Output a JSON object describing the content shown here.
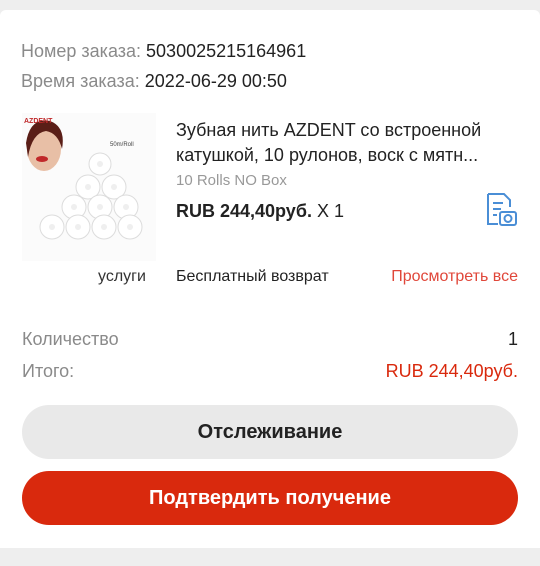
{
  "order": {
    "number_label": "Номер заказа:",
    "number_value": "5030025215164961",
    "time_label": "Время заказа:",
    "time_value": "2022-06-29 00:50"
  },
  "product": {
    "title": "Зубная нить AZDENT со встроенной катушкой, 10 рулонов, воск с мятн...",
    "variant": "10 Rolls NO Box",
    "price": "RUB 244,40руб.",
    "qty_text": "X 1",
    "image_brand": "AZDENT",
    "image_caption": "50m/Roll",
    "invoice_icon": "invoice-camera-icon"
  },
  "services": {
    "label": "услуги",
    "value": "Бесплатный возврат",
    "link": "Просмотреть все"
  },
  "summary": {
    "quantity_label": "Количество",
    "quantity_value": "1",
    "total_label": "Итого:",
    "total_value": "RUB 244,40руб."
  },
  "buttons": {
    "track": "Отслеживание",
    "confirm": "Подтвердить получение"
  },
  "colors": {
    "accent": "#d9290d",
    "link": "#e0473a",
    "muted": "#8a8a8a",
    "icon_blue": "#4a8ed6"
  }
}
